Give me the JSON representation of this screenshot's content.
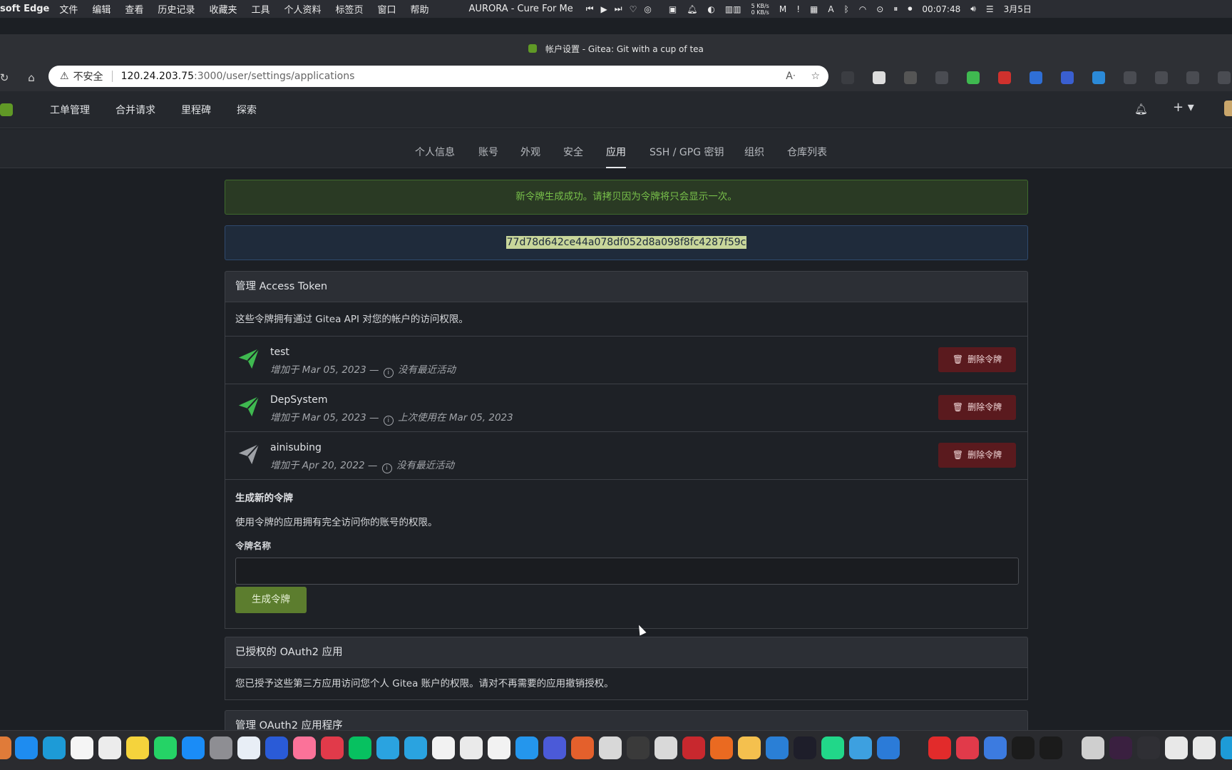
{
  "menubar": {
    "app_name": "soft Edge",
    "menus": [
      "文件",
      "编辑",
      "查看",
      "历史记录",
      "收藏夹",
      "工具",
      "个人资料",
      "标签页",
      "窗口",
      "帮助"
    ],
    "now_playing": "AURORA - Cure For Me",
    "net_up": "5 KB/s",
    "net_down": "0 KB/s",
    "clock": "00:07:48",
    "date": "3月5日"
  },
  "browser": {
    "tab_title": "帐户设置 - Gitea: Git with a cup of tea",
    "insecure_label": "不安全",
    "url_host": "120.24.203.75",
    "url_path": ":3000/user/settings/applications"
  },
  "gitea_nav": {
    "links": [
      "工单管理",
      "合并请求",
      "里程碑",
      "探索"
    ]
  },
  "settings_tabs": [
    {
      "label": "个人信息",
      "active": false
    },
    {
      "label": "账号",
      "active": false
    },
    {
      "label": "外观",
      "active": false
    },
    {
      "label": "安全",
      "active": false
    },
    {
      "label": "应用",
      "active": true
    },
    {
      "label": "SSH / GPG 密钥",
      "active": false
    },
    {
      "label": "组织",
      "active": false
    },
    {
      "label": "仓库列表",
      "active": false
    }
  ],
  "success_message": "新令牌生成成功。请拷贝因为令牌将只会显示一次。",
  "generated_token": "77d78d642ce44a078df052d8a098f8fc4287f59c",
  "access_tokens": {
    "header": "管理 Access Token",
    "description": "这些令牌拥有通过 Gitea API 对您的帐户的访问权限。",
    "delete_label": "删除令牌",
    "tokens": [
      {
        "name": "test",
        "added": "增加于 Mar 05, 2023 —",
        "activity": "没有最近活动",
        "active": true
      },
      {
        "name": "DepSystem",
        "added": "增加于 Mar 05, 2023 —",
        "activity": "上次使用在 Mar 05, 2023",
        "active": true
      },
      {
        "name": "ainisubing",
        "added": "增加于 Apr 20, 2022 —",
        "activity": "没有最近活动",
        "active": false
      }
    ]
  },
  "new_token": {
    "title": "生成新的令牌",
    "description": "使用令牌的应用拥有完全访问你的账号的权限。",
    "field_label": "令牌名称",
    "field_value": "",
    "button_label": "生成令牌"
  },
  "oauth_authorized": {
    "header": "已授权的 OAuth2 应用",
    "description": "您已授予这些第三方应用访问您个人 Gitea 账户的权限。请对不再需要的应用撤销授权。"
  },
  "oauth_manage": {
    "header": "管理 OAuth2 应用程序"
  },
  "colors": {
    "active_token_icon": "#3fb950",
    "inactive_token_icon": "#9ea1a6",
    "gitea_green": "#609926"
  }
}
